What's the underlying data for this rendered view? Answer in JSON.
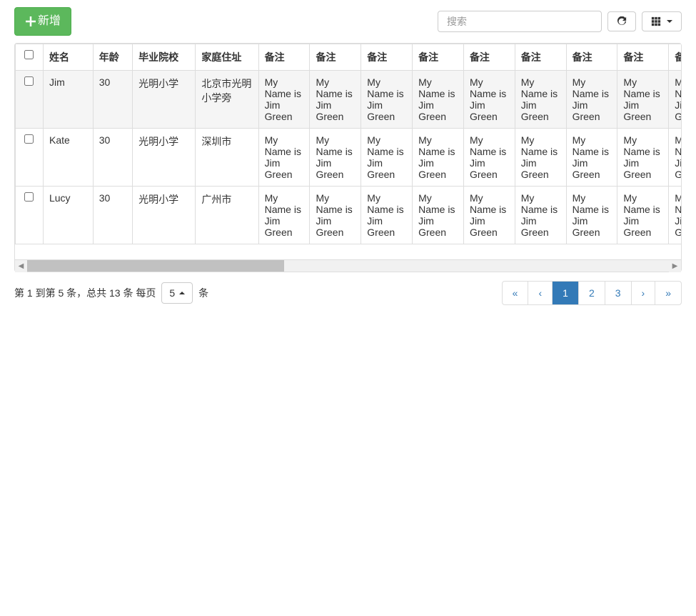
{
  "toolbar": {
    "add_label": "新增",
    "search_placeholder": "搜索"
  },
  "table": {
    "headers": {
      "name": "姓名",
      "age": "年龄",
      "school": "毕业院校",
      "address": "家庭住址",
      "remark": "备注"
    },
    "rows": [
      {
        "name": "Jim",
        "age": "30",
        "school": "光明小学",
        "address": "北京市光明小学旁",
        "remark": "My Name is Jim Green",
        "hover": true
      },
      {
        "name": "Kate",
        "age": "30",
        "school": "光明小学",
        "address": "深圳市",
        "remark": "My Name is Jim Green",
        "hover": false
      },
      {
        "name": "Lucy",
        "age": "30",
        "school": "光明小学",
        "address": "广州市",
        "remark": "My Name is Jim Green",
        "hover": false
      }
    ]
  },
  "pagination": {
    "info_prefix": "第 1 到第 5 条，总共 13 条 每页",
    "page_size": "5",
    "info_suffix": "条",
    "first": "«",
    "prev": "‹",
    "pages": [
      "1",
      "2",
      "3"
    ],
    "active": "1",
    "next": "›",
    "last": "»"
  }
}
